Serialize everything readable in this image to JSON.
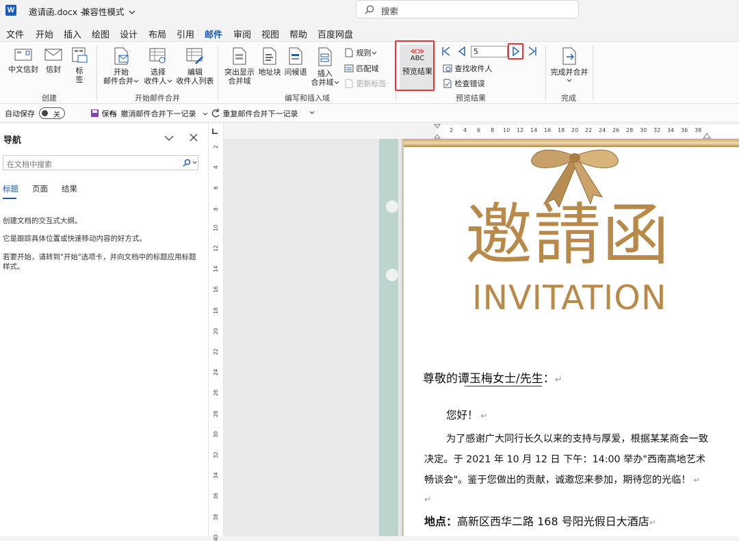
{
  "titlebar": {
    "logo": "W",
    "doc_name": "邀请函.docx",
    "separator": " - ",
    "mode": "兼容性模式",
    "search_placeholder": "搜索"
  },
  "menu": {
    "tabs": [
      "文件",
      "开始",
      "插入",
      "绘图",
      "设计",
      "布局",
      "引用",
      "邮件",
      "审阅",
      "视图",
      "帮助",
      "百度网盘"
    ],
    "active": "邮件"
  },
  "ribbon": {
    "create": {
      "label": "创建",
      "envelope_cn": "中文信封",
      "envelope": "信封",
      "label_btn": "标签"
    },
    "start_merge": {
      "label": "开始邮件合并",
      "start": "开始\n邮件合并",
      "select": "选择\n收件人",
      "edit": "编辑\n收件人列表"
    },
    "write_insert": {
      "label": "编写和插入域",
      "highlight": "突出显示\n合并域",
      "address": "地址块",
      "greeting": "问候语",
      "insert": "插入\n合并域",
      "rules": "规则",
      "match": "匹配域",
      "update": "更新标签"
    },
    "preview": {
      "label": "预览结果",
      "preview_btn": "预览结果",
      "abc": "ABC",
      "record": "5",
      "find": "查找收件人",
      "check": "检查错误"
    },
    "finish": {
      "label": "完成",
      "finish_btn": "完成并合并"
    }
  },
  "qat": {
    "autosave": "自动保存",
    "toggle": "关",
    "save": "保存",
    "undo": "撤消邮件合并下一记录",
    "redo": "重复邮件合并下一记录"
  },
  "nav": {
    "title": "导航",
    "search_placeholder": "在文档中搜索",
    "tabs": [
      "标题",
      "页面",
      "结果"
    ],
    "p1": "创建文档的交互式大纲。",
    "p2": "它是跟踪具体位置或快速移动内容的好方式。",
    "p3": "若要开始，请转到\"开始\"选项卡，并向文档中的标题应用标题样式。"
  },
  "ruler": {
    "h_ticks": [
      "2",
      "4",
      "6",
      "8",
      "10",
      "12",
      "14",
      "16",
      "18",
      "20",
      "22",
      "24",
      "26",
      "28",
      "30",
      "32",
      "34",
      "36",
      "38"
    ],
    "v_ticks": [
      "2",
      "4",
      "6",
      "8",
      "10",
      "12",
      "14",
      "16",
      "18",
      "20",
      "22",
      "24",
      "26",
      "28",
      "30",
      "32",
      "34",
      "36",
      "38",
      "40"
    ]
  },
  "document": {
    "title_cn": "邀請函",
    "title_en": "INVITATION",
    "salutation": "尊敬的谭玉梅女士/先生：",
    "greeting": "您好！",
    "body1": "为了感谢广大同行长久以来的支持与厚爱，根据某某商会一致",
    "body2": "决定。于 2021 年 10 月 12 日 下午：14:00 举办\"西南高地艺术",
    "body3": "畅谈会\"。鉴于您做出的贡献，诚邀您来参加，期待您的光临！",
    "location_label": "地点：",
    "location": "高新区西华二路 168 号阳光假日大酒店"
  },
  "colors": {
    "accent": "#185abd",
    "gold": "#b08a4e",
    "highlight": "#e33333"
  }
}
